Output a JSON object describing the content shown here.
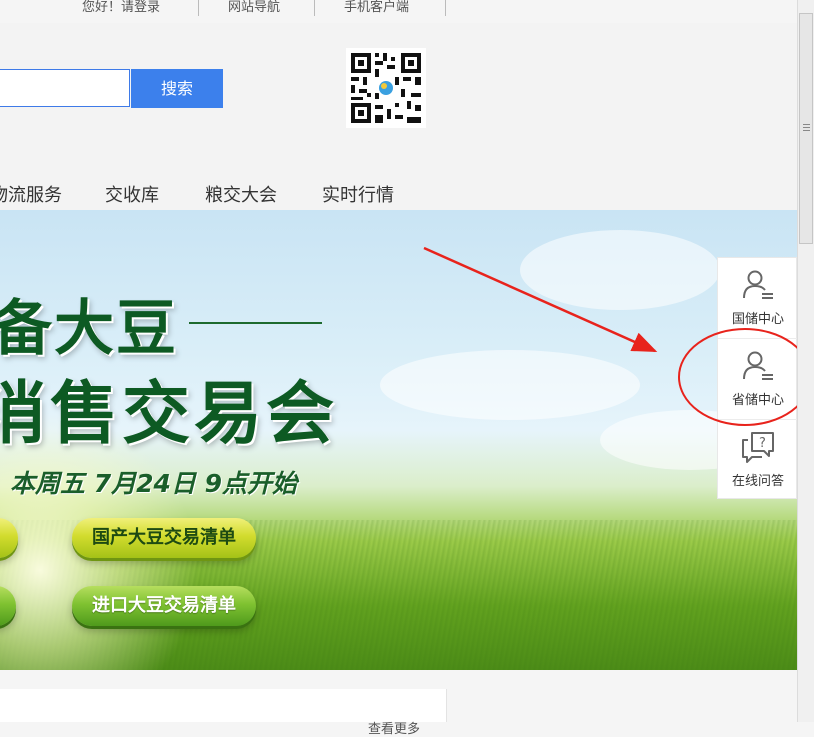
{
  "topbar": {
    "login": "您好！请登录",
    "site_nav": "网站导航",
    "mobile": "手机客户端"
  },
  "search": {
    "button_label": "搜索",
    "placeholder": ""
  },
  "nav": {
    "items": [
      "物流服务",
      "交收库",
      "粮交大会",
      "实时行情"
    ]
  },
  "banner": {
    "title_line1": "备大豆",
    "title_line2": "消售交易会",
    "date_text": "本周五 7月24日 9点开始",
    "btn_domestic": "国产大豆交易清单",
    "btn_import": "进口大豆交易清单"
  },
  "sidebar": {
    "items": [
      {
        "label": "国储中心",
        "icon": "user-list-icon"
      },
      {
        "label": "省储中心",
        "icon": "user-list-icon"
      },
      {
        "label": "在线问答",
        "icon": "question-bubble-icon"
      }
    ]
  },
  "content": {
    "more_label": "查看更多"
  },
  "colors": {
    "accent_blue": "#3c80ec",
    "annotation_red": "#e8231c",
    "title_green": "#0d5a23"
  }
}
